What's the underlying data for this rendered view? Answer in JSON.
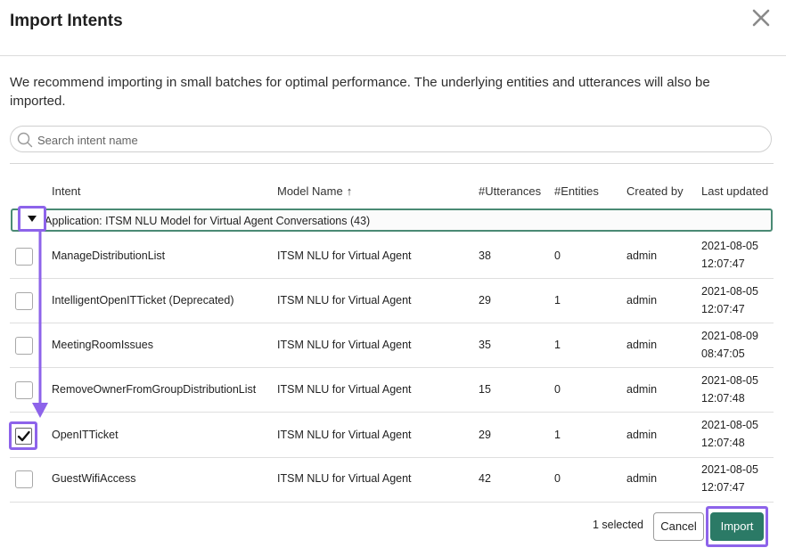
{
  "dialog": {
    "title": "Import Intents",
    "description": "We recommend importing in small batches for optimal performance. The underlying entities and utterances will also be imported."
  },
  "search": {
    "placeholder": "Search intent name",
    "value": ""
  },
  "columns": {
    "intent": "Intent",
    "model_name": "Model Name",
    "model_name_sort": "↑",
    "utterances": "#Utterances",
    "entities": "#Entities",
    "created_by": "Created by",
    "last_updated": "Last updated"
  },
  "group": {
    "label": "Application: ITSM NLU Model for Virtual Agent Conversations (43)",
    "expanded": true
  },
  "rows": [
    {
      "intent": "ManageDistributionList",
      "model": "ITSM NLU for Virtual Agent",
      "utterances": "38",
      "entities": "0",
      "created_by": "admin",
      "date": "2021-08-05",
      "time": "12:07:47",
      "checked": false
    },
    {
      "intent": "IntelligentOpenITTicket (Deprecated)",
      "model": "ITSM NLU for Virtual Agent",
      "utterances": "29",
      "entities": "1",
      "created_by": "admin",
      "date": "2021-08-05",
      "time": "12:07:47",
      "checked": false
    },
    {
      "intent": "MeetingRoomIssues",
      "model": "ITSM NLU for Virtual Agent",
      "utterances": "35",
      "entities": "1",
      "created_by": "admin",
      "date": "2021-08-09",
      "time": "08:47:05",
      "checked": false
    },
    {
      "intent": "RemoveOwnerFromGroupDistributionList",
      "model": "ITSM NLU for Virtual Agent",
      "utterances": "15",
      "entities": "0",
      "created_by": "admin",
      "date": "2021-08-05",
      "time": "12:07:48",
      "checked": false
    },
    {
      "intent": "OpenITTicket",
      "model": "ITSM NLU for Virtual Agent",
      "utterances": "29",
      "entities": "1",
      "created_by": "admin",
      "date": "2021-08-05",
      "time": "12:07:48",
      "checked": true
    },
    {
      "intent": "GuestWifiAccess",
      "model": "ITSM NLU for Virtual Agent",
      "utterances": "42",
      "entities": "0",
      "created_by": "admin",
      "date": "2021-08-05",
      "time": "12:07:47",
      "checked": false
    }
  ],
  "footer": {
    "selected_text": "1 selected",
    "cancel_label": "Cancel",
    "import_label": "Import"
  },
  "colors": {
    "accent": "#2b7a66",
    "highlight": "#8d63ea",
    "group_border": "#4a8a74"
  },
  "icons": {
    "close": "close-icon",
    "search": "search-icon",
    "collapse": "caret-down-icon",
    "check": "checkmark-icon",
    "annotation_arrow": "arrow-down-icon"
  }
}
